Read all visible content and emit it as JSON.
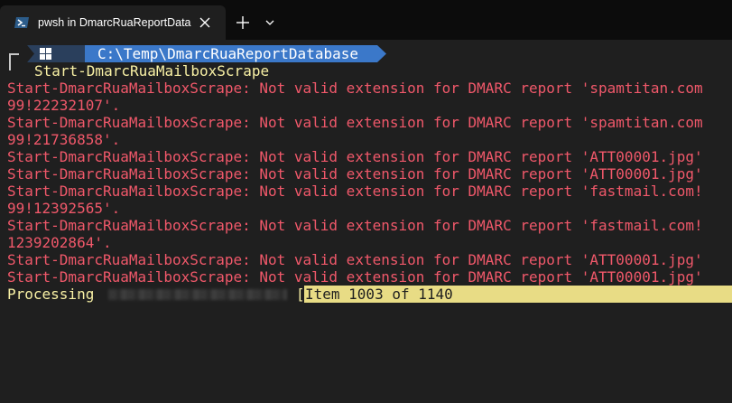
{
  "tab": {
    "title": "pwsh in DmarcRuaReportData",
    "icon": "powershell-icon"
  },
  "prompt": {
    "path": "C:\\Temp\\DmarcRuaReportDatabase",
    "os_icon": "windows-icon",
    "segment_color": "#4a86cf"
  },
  "command": "Start-DmarcRuaMailboxScrape",
  "output_lines": [
    "Start-DmarcRuaMailboxScrape: Not valid extension for DMARC report 'spamtitan.com",
    "99!22232107'.",
    "Start-DmarcRuaMailboxScrape: Not valid extension for DMARC report 'spamtitan.com",
    "99!21736858'.",
    "Start-DmarcRuaMailboxScrape: Not valid extension for DMARC report 'ATT00001.jpg'",
    "Start-DmarcRuaMailboxScrape: Not valid extension for DMARC report 'ATT00001.jpg'",
    "Start-DmarcRuaMailboxScrape: Not valid extension for DMARC report 'fastmail.com!",
    "99!12392565'.",
    "Start-DmarcRuaMailboxScrape: Not valid extension for DMARC report 'fastmail.com!",
    "1239202864'.",
    "Start-DmarcRuaMailboxScrape: Not valid extension for DMARC report 'ATT00001.jpg'",
    "Start-DmarcRuaMailboxScrape: Not valid extension for DMARC report 'ATT00001.jpg'"
  ],
  "progress": {
    "label": "Processing",
    "bracket": "[",
    "status": "Item 1003 of 1140",
    "current": 1003,
    "total": 1140
  },
  "colors": {
    "error": "#f0586a",
    "command": "#f9f1a5",
    "progress_bar": "#e8dc85",
    "background": "#1f1f1f"
  }
}
